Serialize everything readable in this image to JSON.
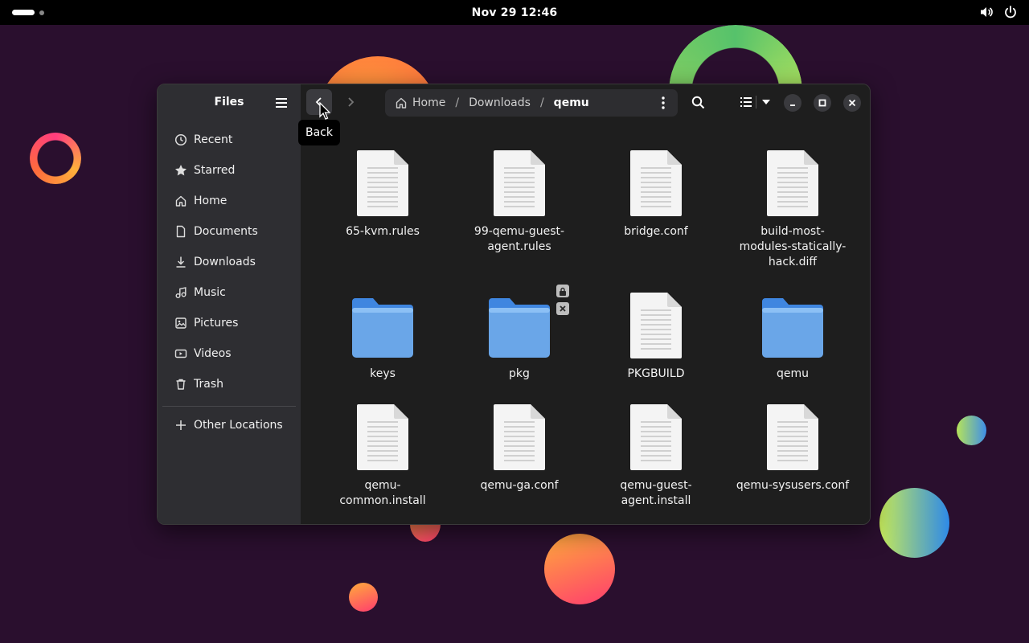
{
  "topbar": {
    "clock": "Nov 29  12:46",
    "icons": [
      "activities-indicator",
      "volume-icon",
      "power-icon"
    ]
  },
  "window": {
    "app_title": "Files",
    "sidebar": {
      "items": [
        {
          "label": "Recent",
          "icon": "clock-icon"
        },
        {
          "label": "Starred",
          "icon": "star-icon"
        },
        {
          "label": "Home",
          "icon": "home-icon"
        },
        {
          "label": "Documents",
          "icon": "document-icon"
        },
        {
          "label": "Downloads",
          "icon": "download-icon"
        },
        {
          "label": "Music",
          "icon": "music-icon"
        },
        {
          "label": "Pictures",
          "icon": "picture-icon"
        },
        {
          "label": "Videos",
          "icon": "video-icon"
        },
        {
          "label": "Trash",
          "icon": "trash-icon"
        }
      ],
      "other_locations": "Other Locations"
    },
    "pathbar": {
      "home": "Home",
      "segments": [
        "Downloads",
        "qemu"
      ],
      "separator": "/"
    },
    "tooltip": "Back",
    "files": [
      {
        "name": "65-kvm.rules",
        "type": "file"
      },
      {
        "name": "99-qemu-guest-agent.rules",
        "line1": "99-qemu-guest-",
        "line2": "agent.rules",
        "type": "file"
      },
      {
        "name": "bridge.conf",
        "type": "file"
      },
      {
        "name": "build-most-modules-statically-hack.diff",
        "line1": "build-most-",
        "line2": "modules-statically-",
        "line3": "hack.diff",
        "type": "file"
      },
      {
        "name": "keys",
        "type": "folder"
      },
      {
        "name": "pkg",
        "type": "folder",
        "emblems": [
          "lock-icon",
          "unreadable-x-icon"
        ]
      },
      {
        "name": "PKGBUILD",
        "type": "file"
      },
      {
        "name": "qemu",
        "type": "folder"
      },
      {
        "name": "qemu-common.install",
        "line1": "qemu-",
        "line2": "common.install",
        "type": "file"
      },
      {
        "name": "qemu-ga.conf",
        "type": "file"
      },
      {
        "name": "qemu-guest-agent.install",
        "line1": "qemu-guest-",
        "line2": "agent.install",
        "type": "file"
      },
      {
        "name": "qemu-sysusers.conf",
        "type": "file"
      }
    ],
    "colors": {
      "folder": "#6aa6e8",
      "folder_tab": "#3f86e0",
      "accent": "#3584e4"
    }
  }
}
